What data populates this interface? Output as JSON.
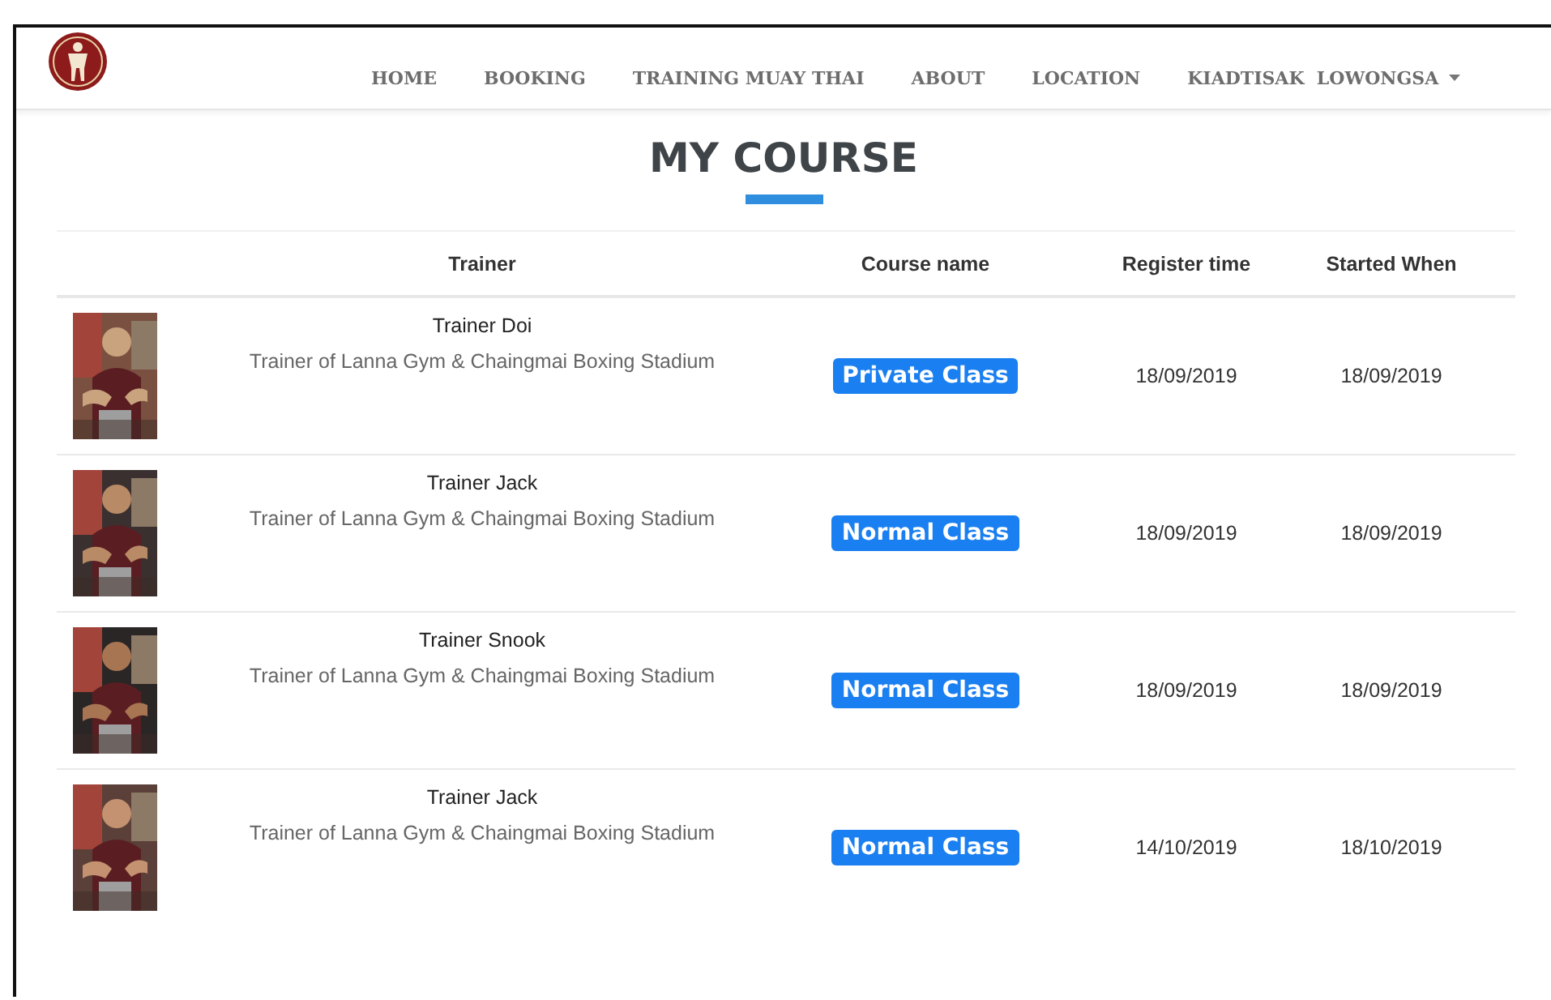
{
  "nav": {
    "items": [
      {
        "label": "HOME"
      },
      {
        "label": "BOOKING"
      },
      {
        "label": "TRAINING MUAY THAI"
      },
      {
        "label": "ABOUT"
      },
      {
        "label": "LOCATION"
      }
    ],
    "user": "KIADTISAK  LOWONGSA"
  },
  "title": "MY COURSE",
  "table": {
    "columns": [
      "Trainer",
      "Course name",
      "Register time",
      "Started When"
    ],
    "rows": [
      {
        "trainer": "Trainer Doi",
        "description": "Trainer of Lanna Gym & Chaingmai Boxing Stadium",
        "course": "Private Class",
        "register_time": "18/09/2019",
        "started": "18/09/2019"
      },
      {
        "trainer": "Trainer Jack",
        "description": "Trainer of Lanna Gym & Chaingmai Boxing Stadium",
        "course": "Normal Class",
        "register_time": "18/09/2019",
        "started": "18/09/2019"
      },
      {
        "trainer": "Trainer Snook",
        "description": "Trainer of Lanna Gym & Chaingmai Boxing Stadium",
        "course": "Normal Class",
        "register_time": "18/09/2019",
        "started": "18/09/2019"
      },
      {
        "trainer": "Trainer Jack",
        "description": "Trainer of Lanna Gym & Chaingmai Boxing Stadium",
        "course": "Normal Class",
        "register_time": "14/10/2019",
        "started": "18/10/2019"
      }
    ]
  }
}
